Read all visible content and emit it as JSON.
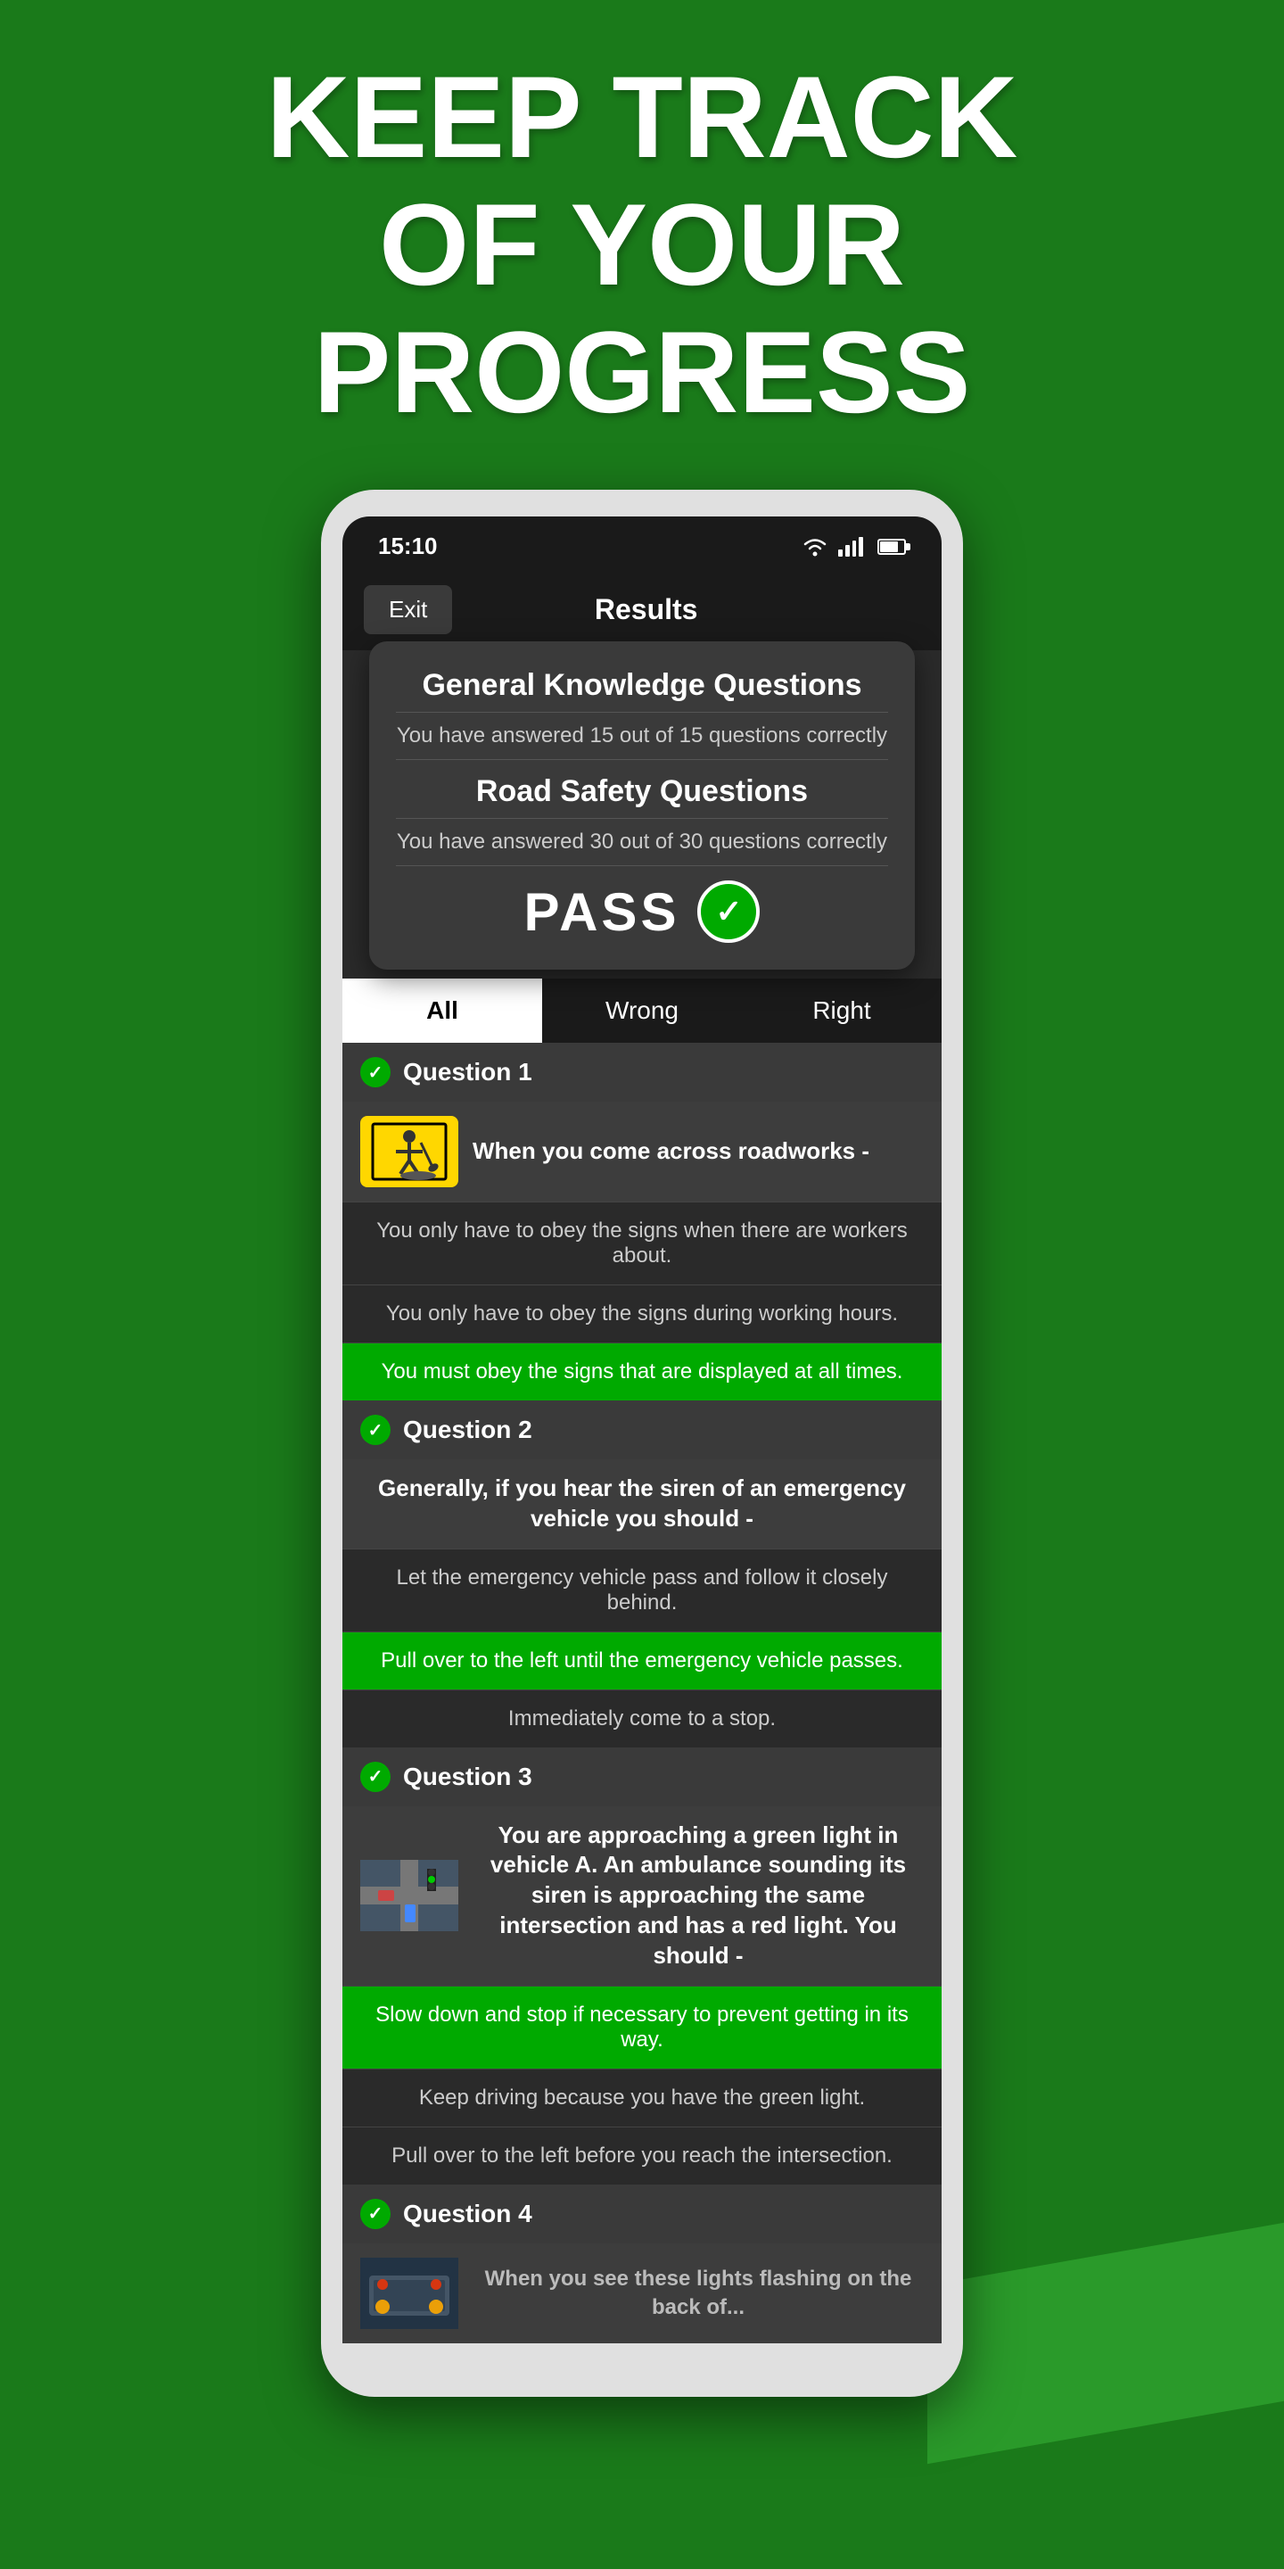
{
  "hero": {
    "line1": "KEEP TRACK",
    "line2": "OF YOUR PROGRESS"
  },
  "phone": {
    "status_bar": {
      "time": "15:10"
    },
    "header": {
      "exit_label": "Exit",
      "title": "Results"
    },
    "results_card": {
      "section1_title": "General Knowledge Questions",
      "section1_subtitle": "You have answered 15 out of 15 questions correctly",
      "section2_title": "Road Safety Questions",
      "section2_subtitle": "You have answered 30 out of 30 questions correctly",
      "pass_label": "PASS"
    },
    "tabs": [
      {
        "label": "All",
        "active": true
      },
      {
        "label": "Wrong",
        "active": false
      },
      {
        "label": "Right",
        "active": false
      }
    ],
    "questions": [
      {
        "number": "Question 1",
        "has_image": true,
        "question_text": "When you come across roadworks -",
        "answers": [
          {
            "text": "You only have to obey the signs when there are workers about.",
            "correct": false
          },
          {
            "text": "You only have to obey the signs during working hours.",
            "correct": false
          },
          {
            "text": "You must obey the signs that are displayed at all times.",
            "correct": true
          }
        ]
      },
      {
        "number": "Question 2",
        "has_image": false,
        "question_text": "Generally, if you hear the siren of an emergency vehicle you should -",
        "answers": [
          {
            "text": "Let the emergency vehicle pass and follow it closely behind.",
            "correct": false
          },
          {
            "text": "Pull over to the left until the emergency vehicle passes.",
            "correct": true
          },
          {
            "text": "Immediately come to a stop.",
            "correct": false
          }
        ]
      },
      {
        "number": "Question 3",
        "has_image": true,
        "question_text": "You are approaching a green light in vehicle A. An ambulance sounding its siren is approaching the same intersection and has a red light. You should -",
        "answers": [
          {
            "text": "Slow down and stop if necessary to prevent getting in its way.",
            "correct": true
          },
          {
            "text": "Keep driving because you have the green light.",
            "correct": false
          },
          {
            "text": "Pull over to the left before you reach the intersection.",
            "correct": false
          }
        ]
      },
      {
        "number": "Question 4",
        "has_image": true,
        "question_text": "When you see these lights flashing on the back of...",
        "answers": []
      }
    ]
  }
}
